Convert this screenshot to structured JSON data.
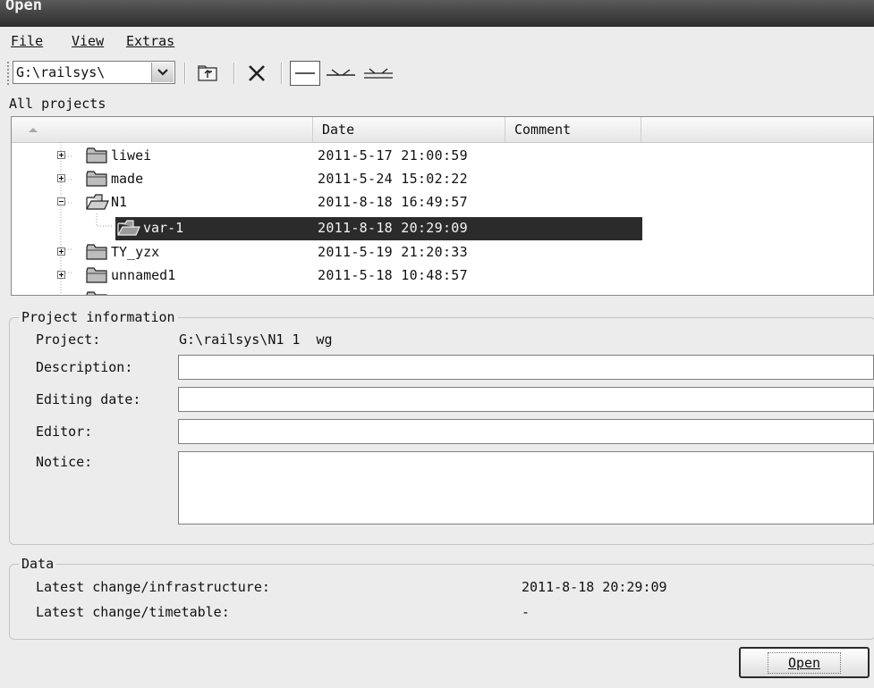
{
  "window": {
    "title": "Open"
  },
  "menu": [
    {
      "label": "File"
    },
    {
      "label": "View"
    },
    {
      "label": "Extras"
    }
  ],
  "toolbar": {
    "path_value": "G:\\railsys\\",
    "icons": [
      "dropdown-arrow-icon",
      "folder-up-icon",
      "delete-icon",
      "line-icon",
      "line-branch-icon",
      "line-double-icon"
    ]
  },
  "tree": {
    "title": "All projects",
    "columns": {
      "name": "",
      "date": "Date",
      "comment": "Comment"
    },
    "rows": [
      {
        "name": "liwei",
        "date": "2011-5-17 21:00:59",
        "expander": "plus",
        "level": 0,
        "selected": false
      },
      {
        "name": "made",
        "date": "2011-5-24 15:02:22",
        "expander": "plus",
        "level": 0,
        "selected": false
      },
      {
        "name": "N1",
        "date": "2011-8-18 16:49:57",
        "expander": "minus",
        "level": 0,
        "selected": false
      },
      {
        "name": "var-1",
        "date": "2011-8-18 20:29:09",
        "expander": "none",
        "level": 1,
        "selected": true
      },
      {
        "name": "TY_yzx",
        "date": "2011-5-19 21:20:33",
        "expander": "plus",
        "level": 0,
        "selected": false
      },
      {
        "name": "unnamed1",
        "date": "2011-5-18 10:48:57",
        "expander": "plus",
        "level": 0,
        "selected": false
      }
    ]
  },
  "project_info": {
    "legend": "Project information",
    "project_label": "Project:",
    "project_value": "G:\\railsys\\N1 1  wg",
    "description_label": "Description:",
    "description_value": "",
    "editing_date_label": "Editing date:",
    "editing_date_value": "",
    "editor_label": "Editor:",
    "editor_value": "",
    "notice_label": "Notice:",
    "notice_value": ""
  },
  "data_section": {
    "legend": "Data",
    "infra_label": "Latest change/infrastructure:",
    "infra_value": "2011-8-18 20:29:09",
    "timetable_label": "Latest change/timetable:",
    "timetable_value": "-"
  },
  "buttons": {
    "open_label": "Open"
  }
}
